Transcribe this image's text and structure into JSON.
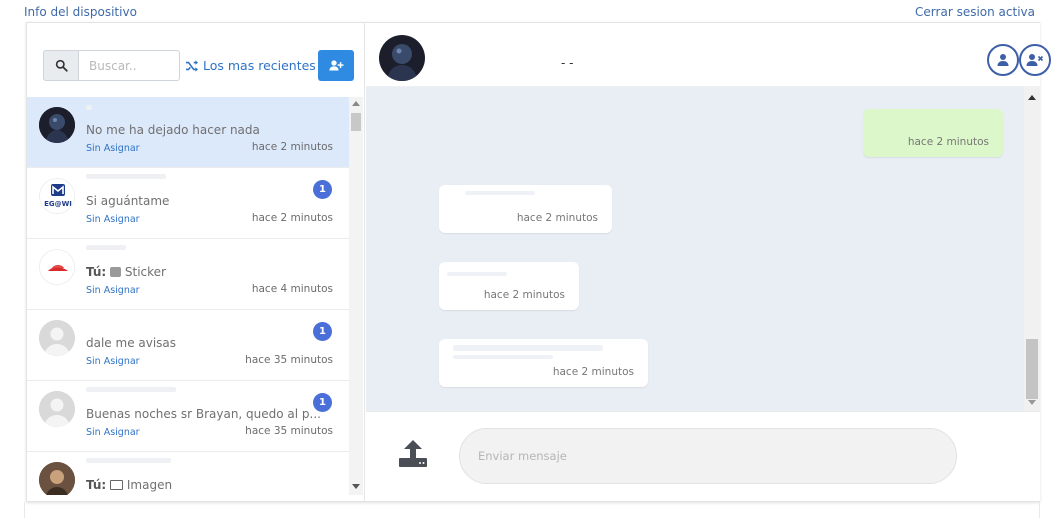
{
  "top": {
    "device_info": "Info del dispositivo",
    "logout": "Cerrar sesion activa"
  },
  "search": {
    "placeholder": "Buscar..",
    "recent_label": "Los mas recientes",
    "icons": {
      "search": "search-icon",
      "shuffle": "shuffle-icon",
      "add": "add-user-icon"
    }
  },
  "conversations": [
    {
      "preview": "No me ha dejado hacer nada",
      "prefix": "",
      "tag": "Sin Asignar",
      "time": "hace 2 minutos",
      "badge": "",
      "active": true
    },
    {
      "preview": "Si aguántame",
      "prefix": "",
      "tag": "Sin Asignar",
      "time": "hace 2 minutos",
      "badge": "1",
      "active": false
    },
    {
      "preview": "Sticker",
      "prefix": "Tú:",
      "tag": "Sin Asignar",
      "time": "hace 4 minutos",
      "badge": "",
      "active": false
    },
    {
      "preview": "dale me avisas",
      "prefix": "",
      "tag": "Sin Asignar",
      "time": "hace 35 minutos",
      "badge": "1",
      "active": false
    },
    {
      "preview": "Buenas noches sr Brayan, quedo al p...",
      "prefix": "",
      "tag": "Sin Asignar",
      "time": "hace 35 minutos",
      "badge": "1",
      "active": false
    },
    {
      "preview": "Imagen",
      "prefix": "Tú:",
      "tag": "",
      "time": "",
      "badge": "",
      "active": false
    }
  ],
  "chat": {
    "contact_name": "- -",
    "messages": [
      {
        "direction": "out",
        "time": "hace 2 minutos"
      },
      {
        "direction": "in",
        "time": "hace 2 minutos"
      },
      {
        "direction": "in",
        "time": "hace 2 minutos"
      },
      {
        "direction": "in",
        "time": "hace 2 minutos"
      }
    ]
  },
  "composer": {
    "placeholder": "Enviar mensaje"
  },
  "colors": {
    "accent": "#2f8ae2",
    "link": "#3f6aa8",
    "active_row": "#dce9fb",
    "badge": "#4a6fd8",
    "outgoing_bubble": "#dcf7c9",
    "chat_bg": "#e9eef5"
  }
}
